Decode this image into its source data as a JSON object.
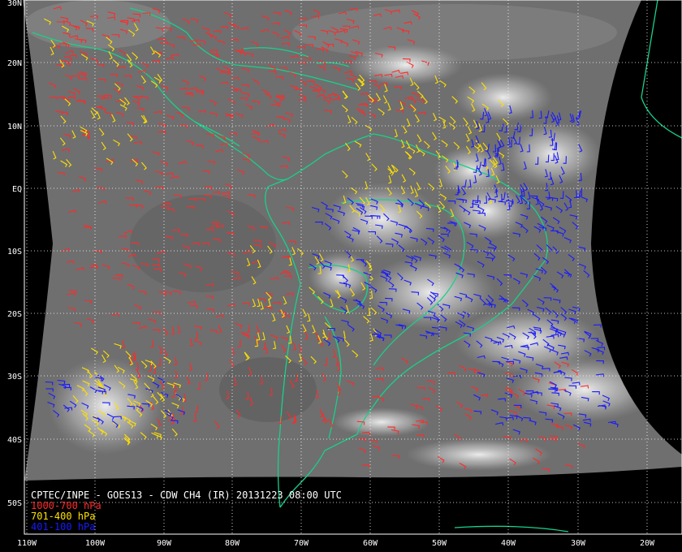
{
  "title": "CPTEC/INPE - GOES13 - CDW CH4 (IR) 20131223 08:00 UTC",
  "legend": [
    {
      "label": "1000-700 hPa",
      "color": "#ff2a2a"
    },
    {
      "label": "701-400 hPa",
      "color": "#ffe000"
    },
    {
      "label": "401-100 hPa",
      "color": "#1a1aff"
    }
  ],
  "grid": {
    "latitude_labels": [
      "30N",
      "20N",
      "10N",
      "EQ",
      "10S",
      "20S",
      "30S",
      "40S",
      "50S"
    ],
    "longitude_labels": [
      "110W",
      "100W",
      "90W",
      "80W",
      "70W",
      "60W",
      "50W",
      "40W",
      "30W",
      "20W"
    ],
    "line_style": "dotted",
    "line_color": "#ffffff"
  },
  "colors": {
    "background": "#000000",
    "coastline": "#19d08a",
    "cloud_image": "#7a7a7a"
  }
}
